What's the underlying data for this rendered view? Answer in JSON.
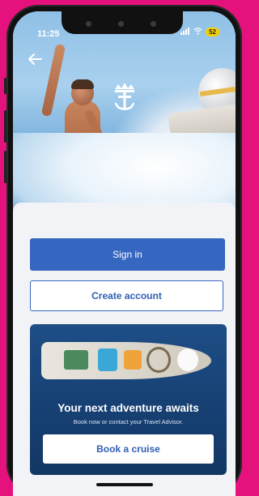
{
  "status_bar": {
    "time": "11:25",
    "battery": "52"
  },
  "hero": {
    "back_icon": "arrow-left-icon",
    "logo_icon": "royal-caribbean-crown-anchor-icon"
  },
  "auth": {
    "sign_in_label": "Sign in",
    "create_account_label": "Create account"
  },
  "promo": {
    "title": "Your next adventure awaits",
    "subtitle": "Book now or contact your Travel Advisor.",
    "button_label": "Book a cruise"
  },
  "colors": {
    "background": "#e5127d",
    "primary": "#3567c0",
    "promo_bg": "#1d4e86"
  }
}
